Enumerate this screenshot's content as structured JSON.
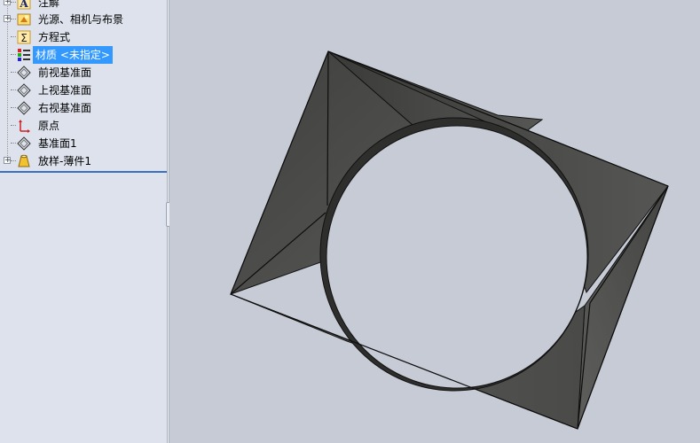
{
  "feature_tree": {
    "items": [
      {
        "label": "注解",
        "icon": "annotation-icon",
        "expandable": true
      },
      {
        "label": "光源、相机与布景",
        "icon": "lights-cameras-icon",
        "expandable": true
      },
      {
        "label": "方程式",
        "icon": "equations-icon",
        "expandable": false
      },
      {
        "label": "材质 <未指定>",
        "icon": "material-icon",
        "expandable": false,
        "selected": true
      },
      {
        "label": "前视基准面",
        "icon": "plane-icon",
        "expandable": false
      },
      {
        "label": "上视基准面",
        "icon": "plane-icon",
        "expandable": false
      },
      {
        "label": "右视基准面",
        "icon": "plane-icon",
        "expandable": false
      },
      {
        "label": "原点",
        "icon": "origin-icon",
        "expandable": false
      },
      {
        "label": "基准面1",
        "icon": "plane-icon",
        "expandable": false
      },
      {
        "label": "放样-薄件1",
        "icon": "loft-thin-feature-icon",
        "expandable": true
      }
    ]
  },
  "colors": {
    "panel_bg": "#dde2ec",
    "viewport_bg": "#c6cbd5",
    "selection": "#3399ff",
    "model_dark": "#4a4a48",
    "model_mid": "#5c5c5a",
    "edge": "#111111"
  }
}
